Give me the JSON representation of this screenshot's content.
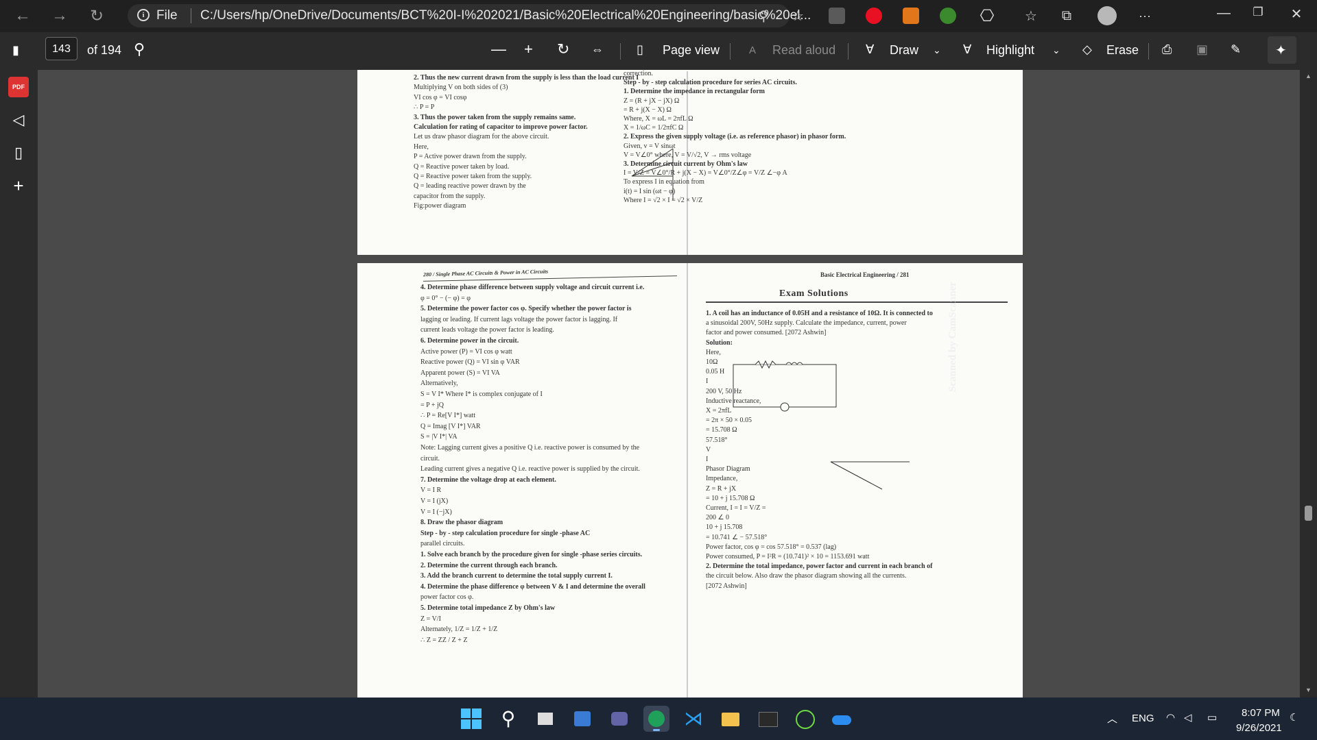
{
  "browser": {
    "file_label": "File",
    "url": "C:/Users/hp/OneDrive/Documents/BCT%20I-I%202021/Basic%20Electrical%20Engineering/basic%20el..."
  },
  "pdf_toolbar": {
    "page_number": "143",
    "page_total": "of 194",
    "page_view": "Page view",
    "read_aloud": "Read aloud",
    "draw": "Draw",
    "highlight": "Highlight",
    "erase": "Erase"
  },
  "page_top": {
    "lines": [
      "2.  Thus the new current drawn from the supply is less than the load current I",
      "Multiplying V on both sides of (3)",
      "VI cos φ = VI cosφ",
      "∴ P = P",
      "3.  Thus the power taken from the supply remains same.",
      "Calculation for rating of capacitor to improve power factor.",
      "Let us draw phasor diagram for the above circuit.",
      "Here,",
      "P = Active power drawn from the supply.",
      "Q = Reactive power taken by load.",
      "Q = Reactive power taken from the supply.",
      "Q = leading reactive power drawn by the",
      "capacitor from the supply.",
      "Fig:power diagram"
    ],
    "right_lines": [
      "correction.",
      "Step - by - step calculation procedure for series AC circuits.",
      "1.  Determine the impedance in rectangular form",
      "Z = (R + jX − jX) Ω",
      "= R + j(X − X) Ω",
      "Where,  X = ωL = 2πfL Ω",
      "X = 1/ωC = 1/2πfC Ω",
      "2.  Express the given supply voltage (i.e. as reference phasor) in phasor form.",
      "Given,   v = V sinωt",
      "V = V∠0° where, V = V/√2, V → rms voltage",
      "3.  Determine circuit current by Ohm's law",
      "I = V/Z = V∠0°/R + j(X − X) = V∠0°/Z∠φ = V/Z ∠−φ A",
      "To express I in equation from",
      "i(t) = I sin (ωt − φ)",
      "Where I = √2 × I = √2 × V/Z"
    ]
  },
  "page_bottom": {
    "header_left": "280 / Single Phase AC Circuits & Power in AC Circuits",
    "header_right": "Basic Electrical Engineering / 281",
    "left_lines": [
      "4.  Determine phase difference between supply voltage and circuit current i.e.",
      "φ = 0° − (− φ) = φ",
      "5.  Determine the power factor cos φ. Specify whether the power factor is",
      "lagging or leading. If current lags voltage the power factor is lagging. If",
      "current leads voltage the power factor is leading.",
      "6.  Determine power in the circuit.",
      "Active power (P) = VI cos φ watt",
      "Reactive power (Q) = VI sin φ VAR",
      "Apparent power (S) = VI VA",
      "Alternatively,",
      "S = V I*   Where I* is complex conjugate of I",
      "= P + jQ",
      "∴   P   =   Re[V I*] watt",
      "Q   =   Imag [V I*] VAR",
      "S   =   |V I*| VA",
      "Note:   Lagging current gives a positive Q i.e. reactive power is consumed by the",
      "circuit.",
      "Leading current gives a negative Q i.e. reactive power is supplied by the circuit.",
      "7.  Determine the voltage drop at each element.",
      "V = I R",
      "V = I (jX)",
      "V = I (−jX)",
      "8.  Draw the phasor diagram",
      "Step - by - step calculation procedure for single -phase AC",
      "parallel circuits.",
      "1.  Solve each branch by the procedure given for single -phase series circuits.",
      "2.  Determine the current through each branch.",
      "3.  Add the branch current to determine the total supply current I.",
      "4.  Determine the phase difference φ between V & I and determine the overall",
      "power factor cos φ.",
      "5.  Determine total impedance Z by Ohm's law",
      "Z = V/I",
      "Alternately,   1/Z = 1/Z + 1/Z",
      "∴ Z = ZZ / Z + Z"
    ],
    "exam_title": "Exam Solutions",
    "right_lines": [
      "1.  A coil has an inductance of 0.05H and a resistance of 10Ω. It is connected to",
      "a sinusoidal 200V, 50Hz supply. Calculate the impedance, current, power",
      "factor and power consumed. [2072 Ashwin]",
      "Solution:",
      "Here,",
      "10Ω",
      "0.05 H",
      "I",
      "200 V, 50 Hz",
      "Inductive reactance,",
      "X   =  2πfL",
      "=   2π × 50 × 0.05",
      "=   15.708 Ω",
      "57.518°",
      "V",
      "I",
      "Phasor Diagram",
      "Impedance,",
      "Z   =   R + jX",
      "= 10 + j 15.708 Ω",
      "Current, I =   I = V/Z =",
      "200 ∠ 0",
      "10 + j 15.708",
      "= 10.741 ∠ − 57.518°",
      "Power factor, cos φ = cos 57.518° = 0.537 (lag)",
      "Power consumed, P = I²R = (10.741)² × 10 = 1153.691 watt",
      "2.  Determine the total impedance, power factor and current in each branch of",
      "the circuit below. Also draw the phasor diagram showing all the currents.",
      "[2072 Ashwin]"
    ],
    "scanner_mark": "Scanned by CamScanner"
  },
  "taskbar": {
    "language": "ENG",
    "time": "8:07 PM",
    "date": "9/26/2021"
  },
  "colors": {
    "titlebar": "#202020",
    "toolbar": "#2b2b2b",
    "viewer_bg": "#4a4a4a",
    "taskbar": "#1c2533"
  }
}
